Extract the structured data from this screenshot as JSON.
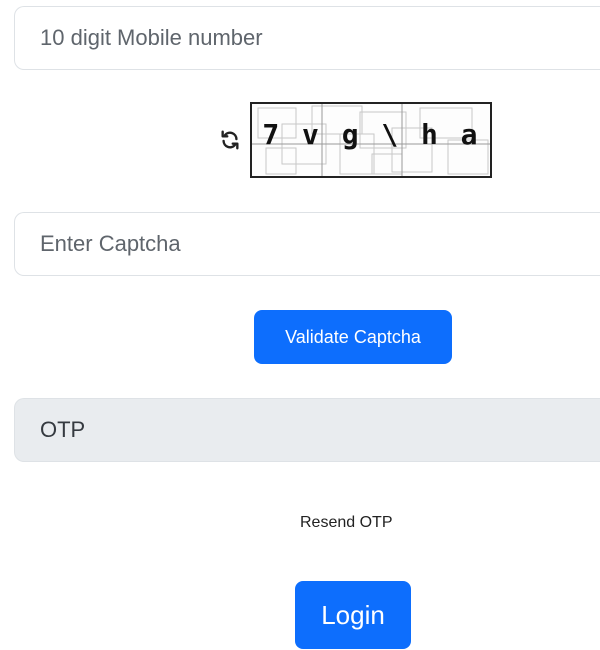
{
  "mobile": {
    "placeholder": "10 digit Mobile number"
  },
  "captcha": {
    "text_chars": [
      "7",
      "v",
      "g",
      "\\",
      "h",
      "a"
    ],
    "refresh_icon": "refresh-icon"
  },
  "captcha_input": {
    "placeholder": "Enter Captcha"
  },
  "buttons": {
    "validate": "Validate Captcha",
    "login": "Login"
  },
  "otp": {
    "placeholder": "OTP"
  },
  "links": {
    "resend": "Resend OTP"
  },
  "colors": {
    "primary": "#0d6efd",
    "otp_bg": "#e9ecef",
    "border": "#dee2e6"
  }
}
